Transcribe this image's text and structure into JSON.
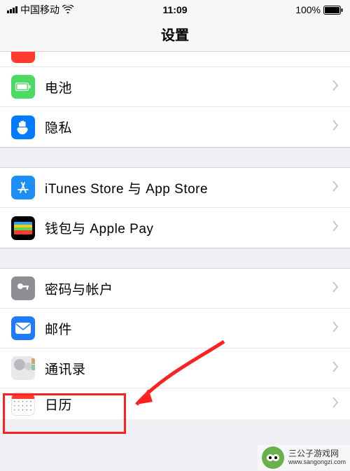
{
  "status": {
    "carrier": "中国移动",
    "time": "11:09",
    "battery": "100%"
  },
  "header": {
    "title": "设置"
  },
  "groups": [
    {
      "rows": [
        {
          "key": "battery",
          "label": "电池",
          "iconClass": "icon-green",
          "iconName": "battery-icon"
        },
        {
          "key": "privacy",
          "label": "隐私",
          "iconClass": "icon-blue",
          "iconName": "hand-icon"
        }
      ]
    },
    {
      "rows": [
        {
          "key": "itunes",
          "label": "iTunes Store 与 App Store",
          "iconClass": "icon-appstore",
          "iconName": "appstore-icon"
        },
        {
          "key": "wallet",
          "label": "钱包与 Apple Pay",
          "iconClass": "icon-wallet",
          "iconName": "wallet-icon"
        }
      ]
    },
    {
      "rows": [
        {
          "key": "passwords",
          "label": "密码与帐户",
          "iconClass": "icon-grey",
          "iconName": "key-icon"
        },
        {
          "key": "mail",
          "label": "邮件",
          "iconClass": "icon-mail",
          "iconName": "mail-icon"
        },
        {
          "key": "contacts",
          "label": "通讯录",
          "iconClass": "icon-contacts",
          "iconName": "contacts-icon"
        },
        {
          "key": "calendar",
          "label": "日历",
          "iconClass": "icon-calendar",
          "iconName": "calendar-icon"
        }
      ]
    }
  ],
  "watermark": {
    "title": "三公子游戏网",
    "url": "www.sangongzi.com"
  }
}
